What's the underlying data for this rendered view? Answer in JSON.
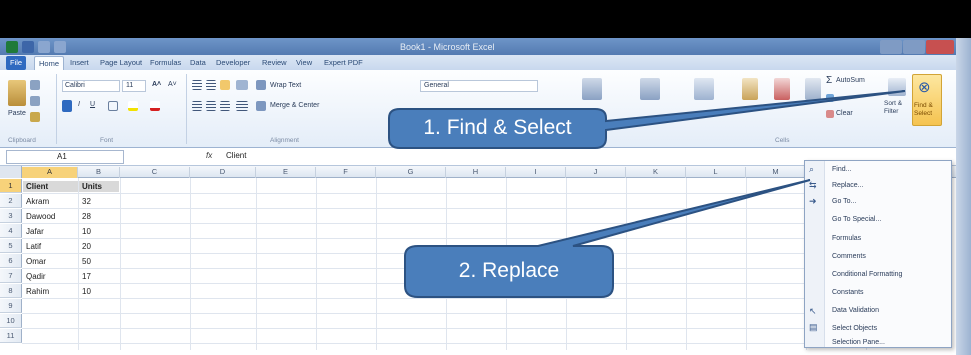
{
  "window": {
    "title": "Book1 - Microsoft Excel"
  },
  "tabs": [
    "File",
    "Home",
    "Insert",
    "Page Layout",
    "Formulas",
    "Data",
    "Developer",
    "Review",
    "View",
    "Expert PDF"
  ],
  "ribbon": {
    "paste_label": "Paste",
    "font_name": "Calibri",
    "font_size": "11",
    "wrap_text": "Wrap Text",
    "merge": "Merge & Center",
    "number_format": "General",
    "autosum": "AutoSum",
    "clear": "Clear",
    "sort_filter": "Sort & Filter",
    "find_select": "Find & Select",
    "groups": {
      "clipboard": "Clipboard",
      "font": "Font",
      "alignment": "Alignment",
      "cells": "Cells"
    }
  },
  "formula_bar": {
    "name_box": "A1",
    "fx": "fx",
    "value": "Client"
  },
  "columns": [
    "A",
    "B",
    "C",
    "D",
    "E",
    "F",
    "G",
    "H",
    "I",
    "J",
    "K",
    "L",
    "M",
    "N"
  ],
  "rows": [
    "1",
    "2",
    "3",
    "4",
    "5",
    "6",
    "7",
    "8",
    "9",
    "10",
    "11"
  ],
  "table": {
    "headers": [
      "Client",
      "Units"
    ],
    "rows": [
      [
        "Akram",
        "32"
      ],
      [
        "Dawood",
        "28"
      ],
      [
        "Jafar",
        "10"
      ],
      [
        "Latif",
        "20"
      ],
      [
        "Omar",
        "50"
      ],
      [
        "Qadir",
        "17"
      ],
      [
        "Rahim",
        "10"
      ]
    ]
  },
  "find_menu": {
    "items": [
      "Find...",
      "Replace...",
      "Go To...",
      "Go To Special...",
      "Formulas",
      "Comments",
      "Conditional Formatting",
      "Constants",
      "Data Validation",
      "Select Objects",
      "Selection Pane..."
    ]
  },
  "callouts": {
    "first": "1. Find & Select",
    "second": "2. Replace"
  },
  "colors": {
    "callout_fill": "#4a7ebb",
    "callout_stroke": "#2c5282",
    "title_bar": "#000000",
    "ribbon_blue": "#2f6ac0",
    "selected_header": "#f7d27a"
  }
}
